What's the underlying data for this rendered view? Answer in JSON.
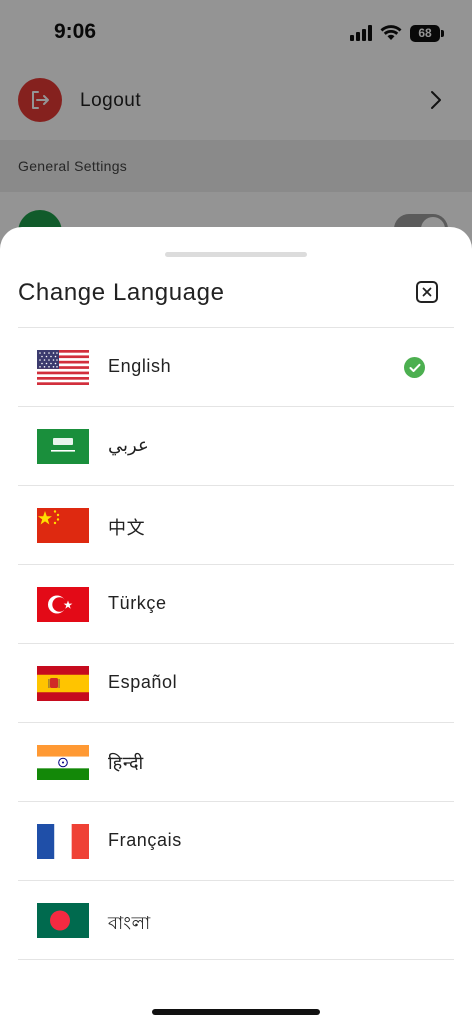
{
  "status_bar": {
    "time": "9:06",
    "battery": "68"
  },
  "background": {
    "logout_label": "Logout",
    "section_header": "General Settings"
  },
  "sheet": {
    "title": "Change Language",
    "languages": [
      {
        "label": "English",
        "flag": "us-flag-icon",
        "selected": true
      },
      {
        "label": "عربي",
        "flag": "saudi-arabia-flag-icon",
        "selected": false
      },
      {
        "label": "中文",
        "flag": "china-flag-icon",
        "selected": false
      },
      {
        "label": "Türkçe",
        "flag": "turkey-flag-icon",
        "selected": false
      },
      {
        "label": "Español",
        "flag": "spain-flag-icon",
        "selected": false
      },
      {
        "label": "हिन्दी",
        "flag": "india-flag-icon",
        "selected": false
      },
      {
        "label": "Français",
        "flag": "france-flag-icon",
        "selected": false
      },
      {
        "label": "বাংলা",
        "flag": "bangladesh-flag-icon",
        "selected": false
      }
    ]
  },
  "colors": {
    "logout_icon_bg": "#e53935",
    "selected_check": "#4caf50",
    "overlay": "rgba(0,0,0,0.42)"
  }
}
